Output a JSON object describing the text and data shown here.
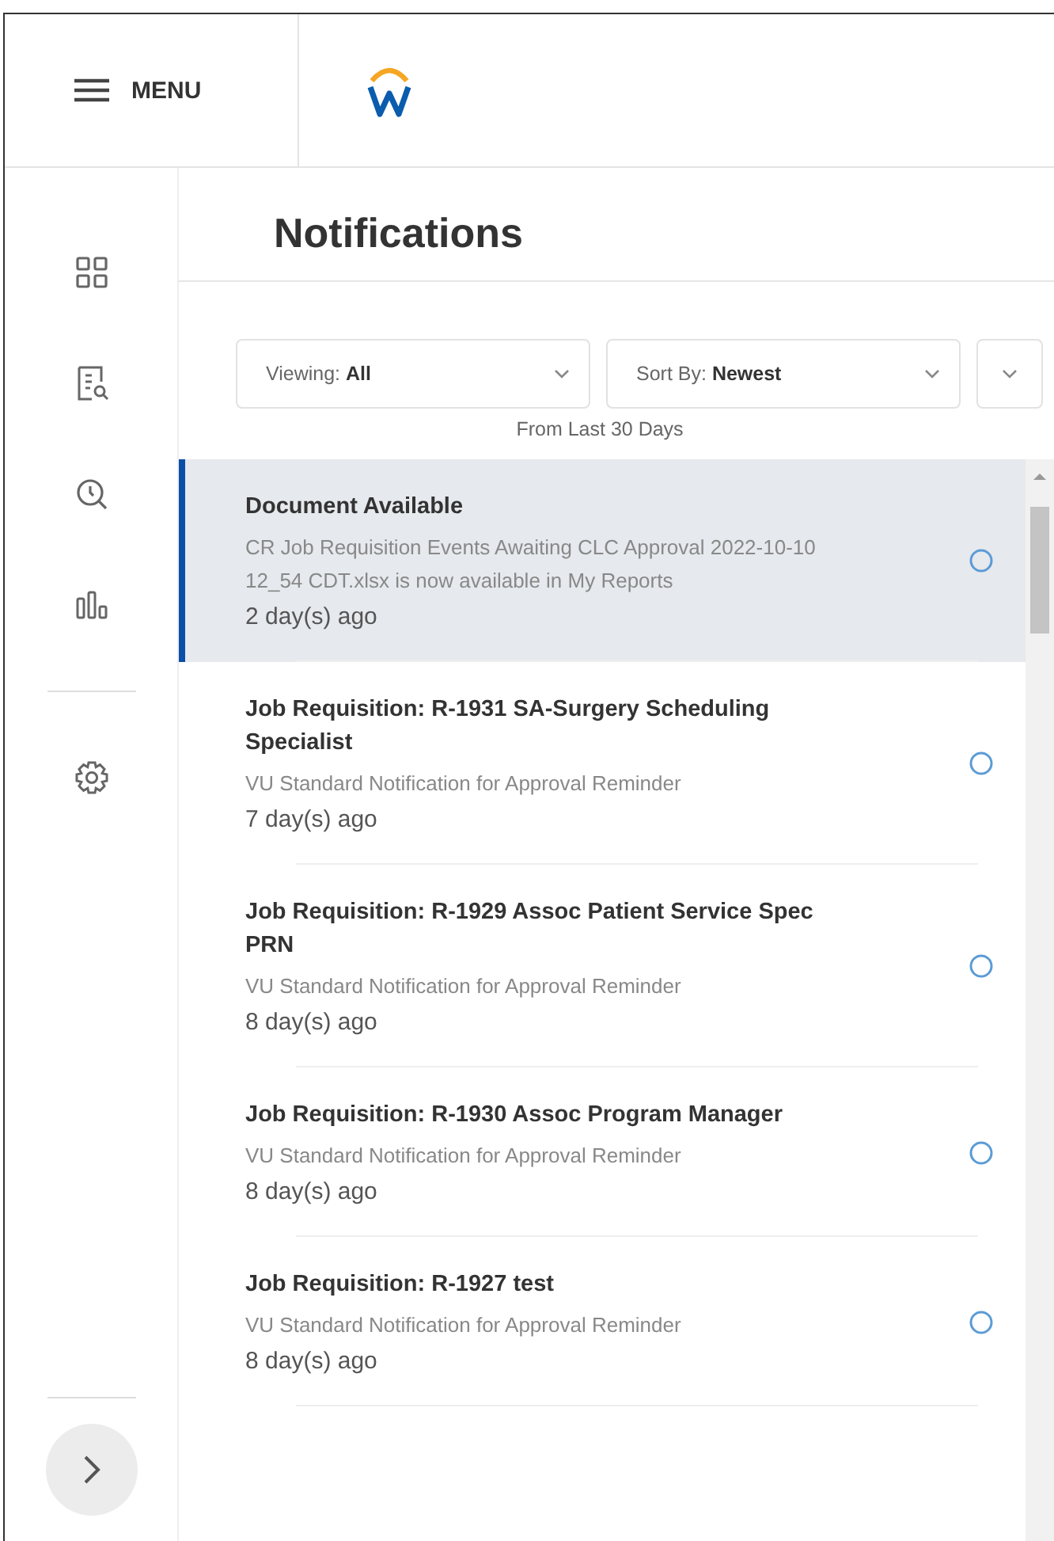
{
  "header": {
    "menu_label": "MENU"
  },
  "page": {
    "title": "Notifications"
  },
  "filters": [
    {
      "kind": "select",
      "label": "Viewing:",
      "value": "All"
    },
    {
      "kind": "select",
      "label": "Sort By:",
      "value": "Newest"
    },
    {
      "kind": "more"
    }
  ],
  "filter_note": "From Last 30 Days",
  "notifications": [
    {
      "title": "Document Available",
      "body": "CR Job Requisition Events Awaiting CLC Approval 2022-10-10 12_54 CDT.xlsx is now available in My Reports",
      "age": "2 day(s) ago",
      "selected": true
    },
    {
      "title": "Job Requisition: R-1931 SA-Surgery Scheduling Specialist",
      "body": "VU Standard Notification for Approval Reminder",
      "age": "7 day(s) ago",
      "selected": false
    },
    {
      "title": "Job Requisition: R-1929 Assoc Patient Service Spec PRN",
      "body": "VU Standard Notification for Approval Reminder",
      "age": "8 day(s) ago",
      "selected": false
    },
    {
      "title": "Job Requisition: R-1930 Assoc Program Manager",
      "body": "VU Standard Notification for Approval Reminder",
      "age": "8 day(s) ago",
      "selected": false
    },
    {
      "title": "Job Requisition: R-1927 test",
      "body": "VU Standard Notification for Approval Reminder",
      "age": "8 day(s) ago",
      "selected": false
    }
  ]
}
